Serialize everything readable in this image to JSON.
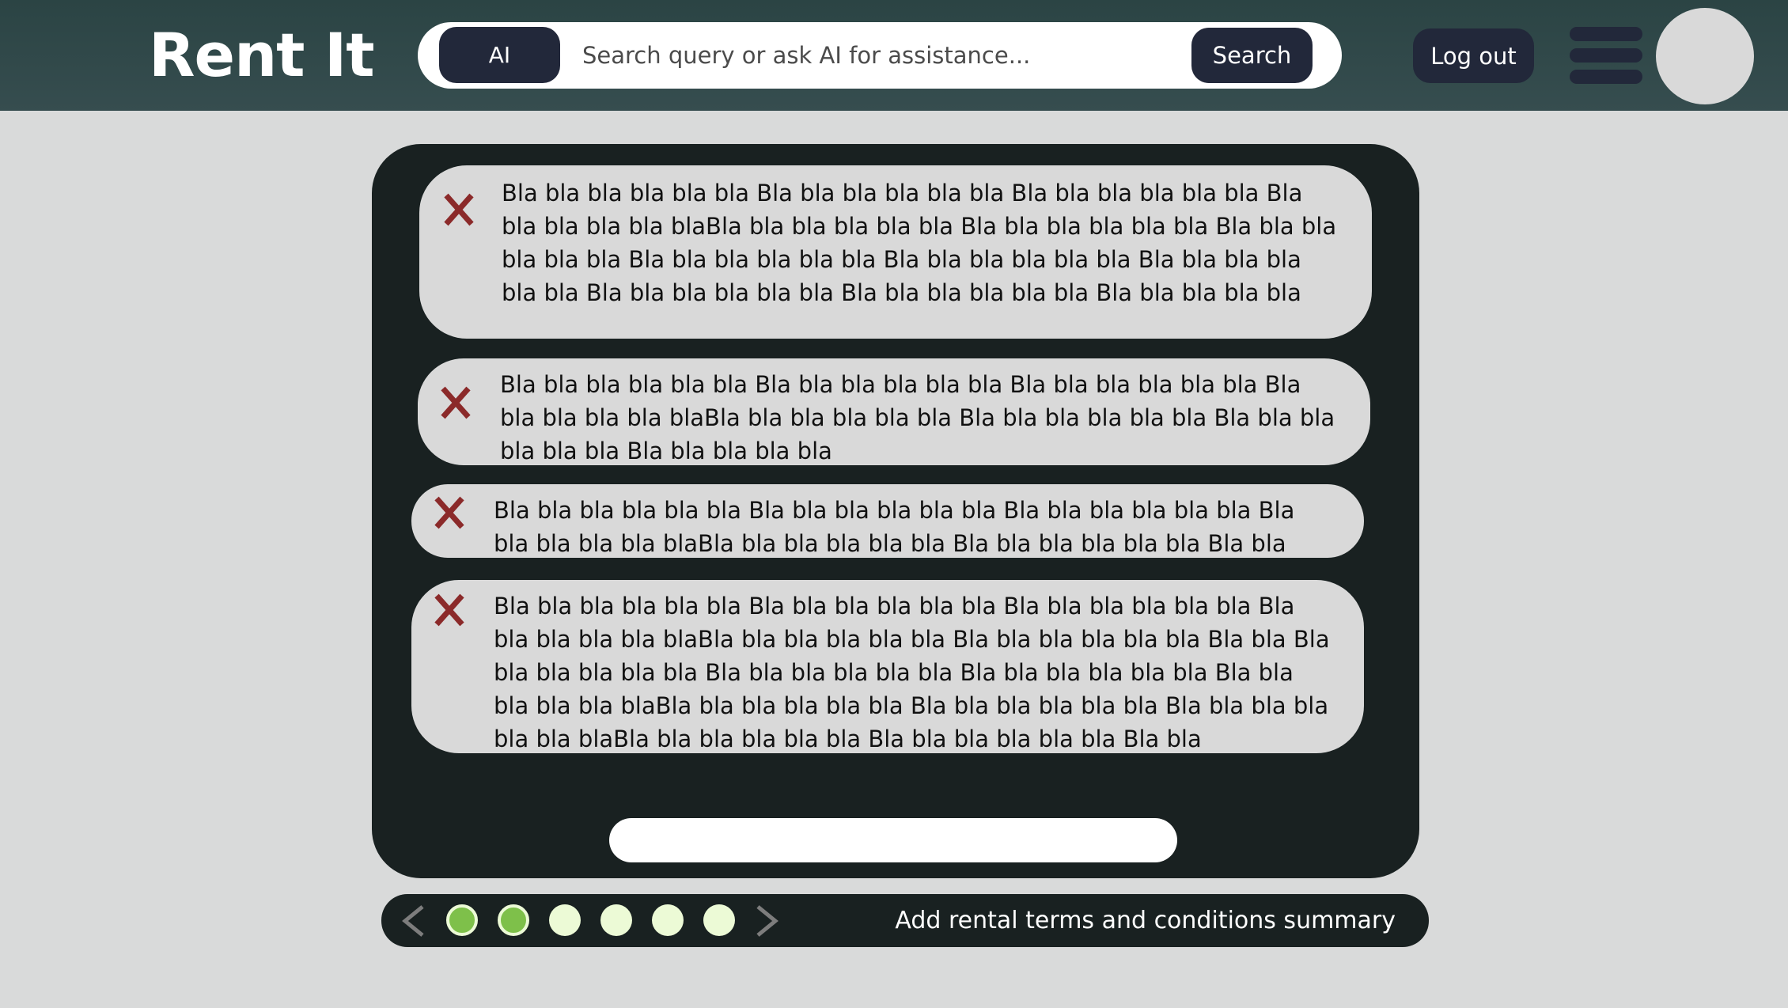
{
  "header": {
    "brand": "Rent It",
    "ai_label": "AI",
    "search_placeholder": "Search query or ask AI for assistance...",
    "search_label": "Search",
    "logout_label": "Log out"
  },
  "cards": [
    {
      "text": "Bla bla bla bla bla bla  Bla bla bla bla bla bla  Bla bla bla bla bla bla  Bla bla bla bla bla blaBla bla bla bla bla bla  Bla bla bla bla bla bla  Bla bla bla bla bla bla  Bla bla bla bla bla bla  Bla bla bla bla bla bla  Bla bla bla bla bla bla  Bla bla bla bla bla bla  Bla bla bla bla bla bla  Bla bla bla bla bla"
    },
    {
      "text": "Bla bla bla bla bla bla  Bla bla bla bla bla bla  Bla bla bla bla bla bla  Bla bla bla bla bla blaBla bla bla bla bla bla  Bla bla bla bla bla bla  Bla bla bla bla bla bla  Bla bla bla bla bla"
    },
    {
      "text": "Bla bla bla bla bla bla  Bla bla bla bla bla bla  Bla bla bla bla bla bla  Bla bla bla bla bla blaBla bla bla bla bla bla  Bla bla bla bla bla bla  Bla bla"
    },
    {
      "text": "Bla bla bla bla bla bla  Bla bla bla bla bla bla  Bla bla bla bla bla bla  Bla bla bla bla bla blaBla bla bla bla bla bla  Bla bla bla bla bla bla  Bla bla Bla bla bla bla bla bla  Bla bla bla bla bla bla  Bla bla bla bla bla bla  Bla bla bla bla bla blaBla bla bla bla bla bla  Bla bla bla bla bla bla  Bla bla bla bla bla bla blaBla bla bla bla bla bla  Bla bla bla bla bla bla  Bla bla"
    }
  ],
  "pager": {
    "total_pages": 6,
    "completed_pages": [
      1,
      2
    ],
    "label": "Add rental terms and conditions summary"
  },
  "colors": {
    "header_bg": "#2b4444",
    "panel_bg": "#192121",
    "button_bg": "#22283a",
    "delete_icon": "#8b2a2a",
    "dot_active": "#7ec04a",
    "dot_inactive": "#ecfad6"
  },
  "icons": {
    "delete": "close-x-icon",
    "menu": "hamburger-menu-icon",
    "prev": "chevron-left-icon",
    "next": "chevron-right-icon"
  }
}
